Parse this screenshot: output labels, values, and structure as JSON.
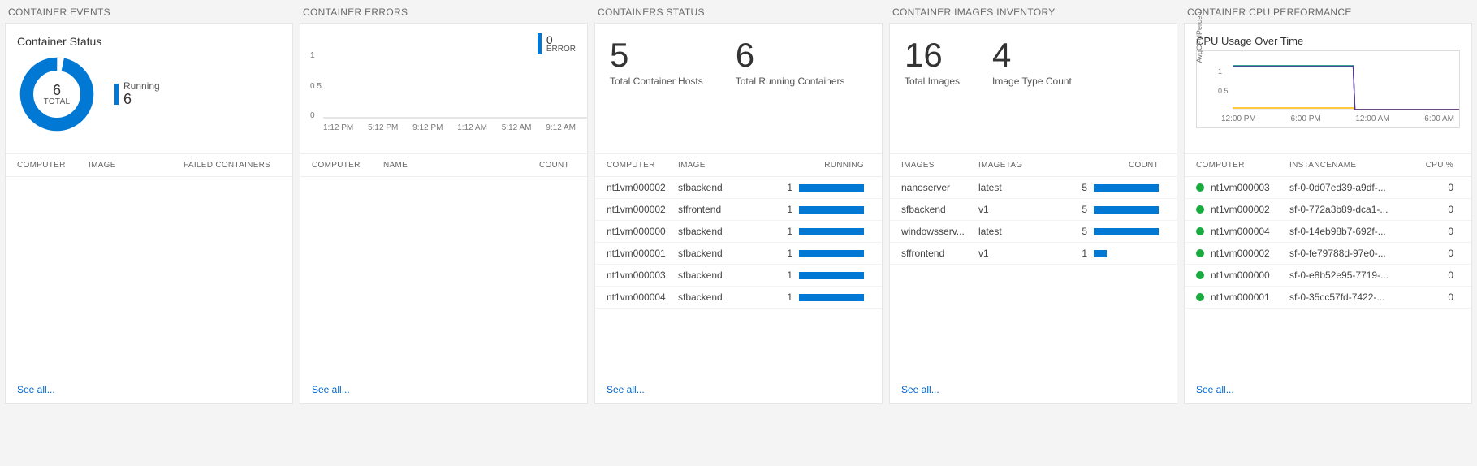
{
  "panes": {
    "events": {
      "title": "CONTAINER EVENTS",
      "card_title": "Container Status",
      "donut": {
        "value": "6",
        "total_label": "TOTAL",
        "legend_label": "Running",
        "legend_value": "6"
      },
      "columns": {
        "computer": "COMPUTER",
        "image": "IMAGE",
        "failed": "FAILED CONTAINERS"
      },
      "see_all": "See all..."
    },
    "errors": {
      "title": "CONTAINER ERRORS",
      "legend": {
        "value": "0",
        "label": "ERROR"
      },
      "columns": {
        "computer": "COMPUTER",
        "name": "NAME",
        "count": "COUNT"
      },
      "see_all": "See all...",
      "chart_data": {
        "type": "line",
        "y_ticks": [
          "1",
          "0.5",
          "0"
        ],
        "x_ticks": [
          "1:12 PM",
          "5:12 PM",
          "9:12 PM",
          "1:12 AM",
          "5:12 AM",
          "9:12 AM"
        ],
        "series": [
          {
            "name": "ERROR",
            "values": [
              0,
              0,
              0,
              0,
              0,
              0
            ]
          }
        ]
      }
    },
    "status": {
      "title": "CONTAINERS STATUS",
      "stats": {
        "hosts_value": "5",
        "hosts_label": "Total Container Hosts",
        "running_value": "6",
        "running_label": "Total Running Containers"
      },
      "columns": {
        "computer": "COMPUTER",
        "image": "IMAGE",
        "running": "RUNNING"
      },
      "rows": [
        {
          "computer": "nt1vm000002",
          "image": "sfbackend",
          "running": "1",
          "frac": 1.0
        },
        {
          "computer": "nt1vm000002",
          "image": "sffrontend",
          "running": "1",
          "frac": 1.0
        },
        {
          "computer": "nt1vm000000",
          "image": "sfbackend",
          "running": "1",
          "frac": 1.0
        },
        {
          "computer": "nt1vm000001",
          "image": "sfbackend",
          "running": "1",
          "frac": 1.0
        },
        {
          "computer": "nt1vm000003",
          "image": "sfbackend",
          "running": "1",
          "frac": 1.0
        },
        {
          "computer": "nt1vm000004",
          "image": "sfbackend",
          "running": "1",
          "frac": 1.0
        }
      ],
      "see_all": "See all..."
    },
    "inventory": {
      "title": "CONTAINER IMAGES INVENTORY",
      "stats": {
        "images_value": "16",
        "images_label": "Total Images",
        "types_value": "4",
        "types_label": "Image Type Count"
      },
      "columns": {
        "images": "IMAGES",
        "tag": "IMAGETAG",
        "count": "COUNT"
      },
      "rows": [
        {
          "images": "nanoserver",
          "tag": "latest",
          "count": "5",
          "frac": 1.0
        },
        {
          "images": "sfbackend",
          "tag": "v1",
          "count": "5",
          "frac": 1.0
        },
        {
          "images": "windowsserv...",
          "tag": "latest",
          "count": "5",
          "frac": 1.0
        },
        {
          "images": "sffrontend",
          "tag": "v1",
          "count": "1",
          "frac": 0.2
        }
      ],
      "see_all": "See all..."
    },
    "cpu": {
      "title": "CONTAINER CPU PERFORMANCE",
      "card_title": "CPU Usage Over Time",
      "yaxis_label": "AvgCPUPercent",
      "chart_data": {
        "type": "line",
        "y_ticks": [
          "1",
          "0.5"
        ],
        "x_ticks": [
          "12:00 PM",
          "6:00 PM",
          "12:00 AM",
          "6:00 AM"
        ],
        "series_note": "multiple container series; all drop to ~0 after 12:00 AM",
        "ylim": [
          0,
          1.2
        ]
      },
      "columns": {
        "computer": "COMPUTER",
        "instance": "INSTANCENAME",
        "cpu": "CPU %"
      },
      "rows": [
        {
          "computer": "nt1vm000003",
          "instance": "sf-0-0d07ed39-a9df-...",
          "cpu": "0"
        },
        {
          "computer": "nt1vm000002",
          "instance": "sf-0-772a3b89-dca1-...",
          "cpu": "0"
        },
        {
          "computer": "nt1vm000004",
          "instance": "sf-0-14eb98b7-692f-...",
          "cpu": "0"
        },
        {
          "computer": "nt1vm000002",
          "instance": "sf-0-fe79788d-97e0-...",
          "cpu": "0"
        },
        {
          "computer": "nt1vm000000",
          "instance": "sf-0-e8b52e95-7719-...",
          "cpu": "0"
        },
        {
          "computer": "nt1vm000001",
          "instance": "sf-0-35cc57fd-7422-...",
          "cpu": "0"
        }
      ],
      "see_all": "See all..."
    }
  }
}
